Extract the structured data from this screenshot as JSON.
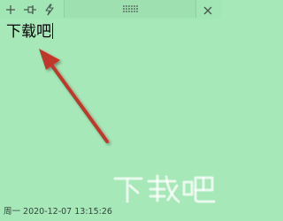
{
  "toolbar": {
    "buttons": [
      {
        "icon": "add-note-icon"
      },
      {
        "icon": "pin-icon"
      },
      {
        "icon": "lightning-icon"
      }
    ],
    "close_icon": "close-icon"
  },
  "note": {
    "text": "下载吧",
    "background": "#a6e8b8"
  },
  "annotation": {
    "arrow_color": "#c0392b"
  },
  "watermark": {
    "text": "下载吧"
  },
  "status": {
    "timestamp": "周一 2020-12-07 13:15:26"
  }
}
